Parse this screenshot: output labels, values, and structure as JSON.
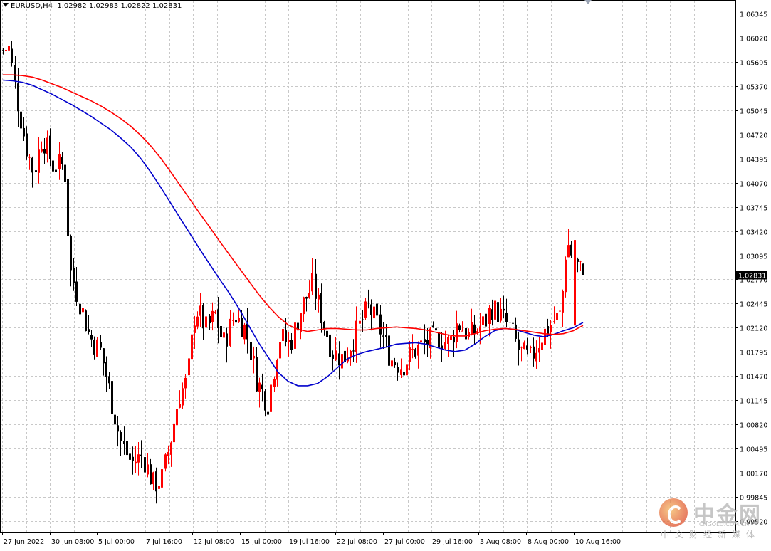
{
  "header": {
    "symbol_timeframe": "EURUSD,H4",
    "ohlc": "1.02982 1.02983 1.02822 1.02831"
  },
  "colors": {
    "background": "#ffffff",
    "grid": "#c8c8c8",
    "bull_candle": "#ff0000",
    "bear_candle": "#000000",
    "ma_fast": "#0000cc",
    "ma_slow": "#ff0000",
    "current_price_line": "#a0a0a0",
    "price_badge": "#000000"
  },
  "watermark": {
    "name": "中金网",
    "sub": "CNGOLD.COM.CN",
    "cn": "中文财经新媒体"
  },
  "chart_data": {
    "type": "candlestick",
    "title": "EURUSD,H4",
    "ohlc_last": {
      "open": 1.02982,
      "high": 1.02983,
      "low": 1.02822,
      "close": 1.02831
    },
    "current_price": 1.02831,
    "current_price_label": "1.02831",
    "ylim": [
      0.9952,
      1.06345
    ],
    "y_ticks": [
      "1.06345",
      "1.06020",
      "1.05695",
      "1.05370",
      "1.05045",
      "1.04720",
      "1.04395",
      "1.04070",
      "1.03745",
      "1.03420",
      "1.03095",
      "1.02770",
      "1.02445",
      "1.02120",
      "1.01795",
      "1.01470",
      "1.01145",
      "1.00820",
      "1.00495",
      "1.00170",
      "0.99845",
      "0.99520"
    ],
    "x_ticks": [
      "27 Jun 2022",
      "30 Jun 08:00",
      "5 Jul 00:00",
      "7 Jul 16:00",
      "12 Jul 08:00",
      "15 Jul 00:00",
      "19 Jul 16:00",
      "22 Jul 08:00",
      "27 Jul 00:00",
      "29 Jul 16:00",
      "3 Aug 08:00",
      "8 Aug 00:00",
      "10 Aug 16:00"
    ],
    "grid": true,
    "series": [
      {
        "name": "",
        "type": "ma",
        "color": "#0000cc",
        "values": [
          1.0545,
          1.0544,
          1.0542,
          1.0538,
          1.0532,
          1.0526,
          1.0519,
          1.0512,
          1.0504,
          1.0496,
          1.0487,
          1.0478,
          1.0467,
          1.0455,
          1.044,
          1.0422,
          1.0402,
          1.0381,
          1.036,
          1.0339,
          1.0318,
          1.0298,
          1.0278,
          1.0259,
          1.0238,
          1.0215,
          1.0192,
          1.0172,
          1.0152,
          1.014,
          1.0134,
          1.0134,
          1.0137,
          1.0146,
          1.0158,
          1.017,
          1.0176,
          1.018,
          1.0183,
          1.0186,
          1.019,
          1.0191,
          1.0192,
          1.019,
          1.0186,
          1.0182,
          1.018,
          1.0182,
          1.019,
          1.02,
          1.0208,
          1.0211,
          1.021,
          1.0206,
          1.0202,
          1.02,
          1.0203,
          1.0208,
          1.0212,
          1.0219
        ]
      },
      {
        "name": "",
        "type": "ma",
        "color": "#ff0000",
        "values": [
          1.0552,
          1.0552,
          1.0551,
          1.0549,
          1.0545,
          1.054,
          1.0535,
          1.0529,
          1.0523,
          1.0517,
          1.051,
          1.0502,
          1.0493,
          1.0483,
          1.0471,
          1.0457,
          1.0441,
          1.0423,
          1.0404,
          1.0385,
          1.0366,
          1.0348,
          1.0329,
          1.0311,
          1.0293,
          1.0275,
          1.0257,
          1.0241,
          1.0227,
          1.0216,
          1.021,
          1.0207,
          1.0209,
          1.0211,
          1.0211,
          1.021,
          1.0209,
          1.0209,
          1.0211,
          1.0212,
          1.0213,
          1.0212,
          1.0211,
          1.0209,
          1.0206,
          1.0203,
          1.0201,
          1.0201,
          1.0204,
          1.0208,
          1.021,
          1.0211,
          1.021,
          1.0208,
          1.0206,
          1.0204,
          1.0203,
          1.0204,
          1.0208,
          1.0215
        ]
      }
    ],
    "candles_summary": {
      "count": 198,
      "first_close": 1.0585,
      "lowest_low": 0.9952,
      "highest_high": 1.0365,
      "last_close": 1.02831
    }
  }
}
